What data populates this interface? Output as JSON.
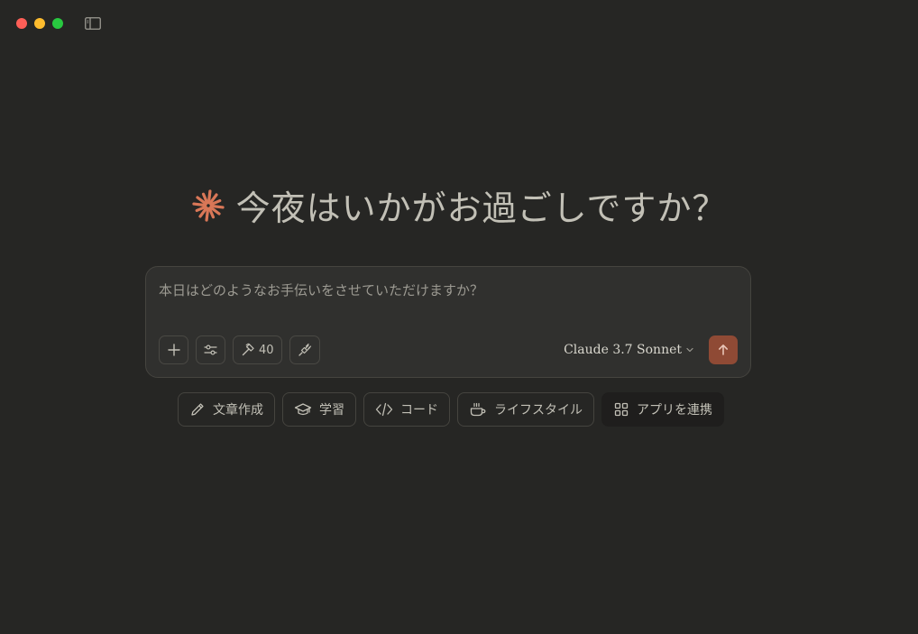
{
  "window": {
    "controls": [
      "close",
      "minimize",
      "maximize"
    ],
    "sidebar_toggle_icon": "sidebar-icon"
  },
  "greeting": {
    "icon": "claude-spark-icon",
    "icon_color": "#d97757",
    "text": "今夜はいかがお過ごしですか？"
  },
  "composer": {
    "placeholder": "本日はどのようなお手伝いをさせていただけますか？",
    "value": "",
    "tools": [
      {
        "name": "add",
        "icon": "plus-icon"
      },
      {
        "name": "settings",
        "icon": "sliders-icon"
      },
      {
        "name": "tools",
        "icon": "hammer-icon",
        "count": "40"
      },
      {
        "name": "integrations",
        "icon": "plug-icon"
      }
    ],
    "model": "Claude 3.7 Sonnet",
    "send_color": "#8f4a35"
  },
  "chips": [
    {
      "label": "文章作成",
      "icon": "pencil-icon"
    },
    {
      "label": "学習",
      "icon": "graduation-cap-icon"
    },
    {
      "label": "コード",
      "icon": "code-icon"
    },
    {
      "label": "ライフスタイル",
      "icon": "coffee-cup-icon"
    },
    {
      "label": "アプリを連携",
      "icon": "apps-grid-icon"
    }
  ]
}
